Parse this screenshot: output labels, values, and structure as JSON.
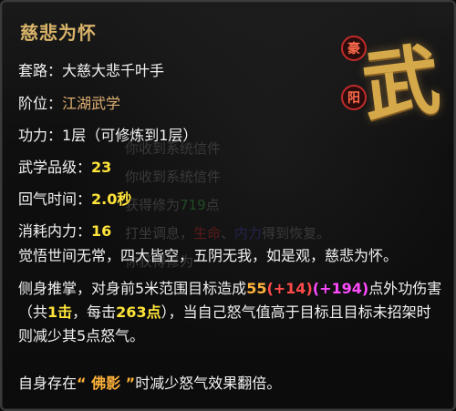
{
  "title": "慈悲为怀",
  "seal": {
    "big": "武",
    "badge_top": "豪",
    "badge_bottom": "阳"
  },
  "stats": [
    {
      "label": "套路：",
      "value": "大慈大悲千叶手",
      "style": "normal"
    },
    {
      "label": "阶位：",
      "value": "江湖武学",
      "style": "orange"
    },
    {
      "label": "功力：",
      "value": "1层（可修炼到1层）",
      "style": "normal"
    },
    {
      "label": "武学品级：",
      "value": "23",
      "style": "yellow"
    },
    {
      "label": "回气时间：",
      "value": "2.0秒",
      "style": "yellow"
    },
    {
      "label": "消耗内力：",
      "value": "16",
      "style": "yellow"
    }
  ],
  "background_messages": [
    {
      "text": "你收到系统信件"
    },
    {
      "text": "你收到系统信件"
    },
    {
      "pre": "获得修为",
      "num": "719",
      "post": "点"
    },
    {
      "pre": "打坐调息，",
      "r": "生命",
      "mid": "、",
      "b": "内力",
      "post": "得到恢复。"
    },
    {
      "text": "你获得修为"
    }
  ],
  "description": {
    "line1": "觉悟世间无常，四大皆空，五阴无我，如是观，慈悲为怀。",
    "p2_a": "侧身推掌，对身前5米范围目标造成",
    "p2_dmg": "55",
    "p2_b1": "(+14)",
    "p2_b2": "(+194)",
    "p2_c": "点外功伤害（共",
    "p2_hits": "1击",
    "p2_d": "，每击",
    "p2_each": "263点",
    "p2_e": "），当自己怒气值高于目标且目标未招架时则减少其5点怒气。",
    "p3_a": "自身存在",
    "p3_quote": "“ 佛影 ”",
    "p3_b": "时减少怒气效果翻倍。"
  }
}
